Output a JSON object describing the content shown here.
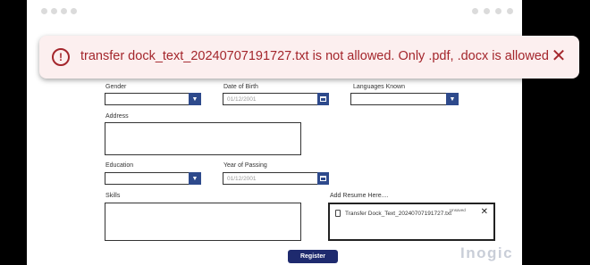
{
  "toast": {
    "message": "transfer dock_text_20240707191727.txt is not allowed. Only .pdf, .docx is allowed",
    "icon": "error-circle-icon",
    "close_icon": "close-icon",
    "color": "#a4262c",
    "background": "#fcefef"
  },
  "form": {
    "gender": {
      "label": "Gender",
      "value": ""
    },
    "dob": {
      "label": "Date of Birth",
      "value": "01/12/2001"
    },
    "languages": {
      "label": "Languages Known",
      "value": ""
    },
    "address": {
      "label": "Address",
      "value": ""
    },
    "education": {
      "label": "Education",
      "value": ""
    },
    "year_of_passing": {
      "label": "Year of Passing",
      "value": "01/12/2001"
    },
    "skills": {
      "label": "Skills",
      "value": ""
    },
    "resume": {
      "label": "Add Resume Here....",
      "file_name": "Transfer Dock_Text_20240707191727.txt",
      "file_status": "Unsaved"
    },
    "register_label": "Register"
  },
  "brand": "Inogic",
  "colors": {
    "accent": "#2e4a8c",
    "button": "#1e2a6e"
  }
}
